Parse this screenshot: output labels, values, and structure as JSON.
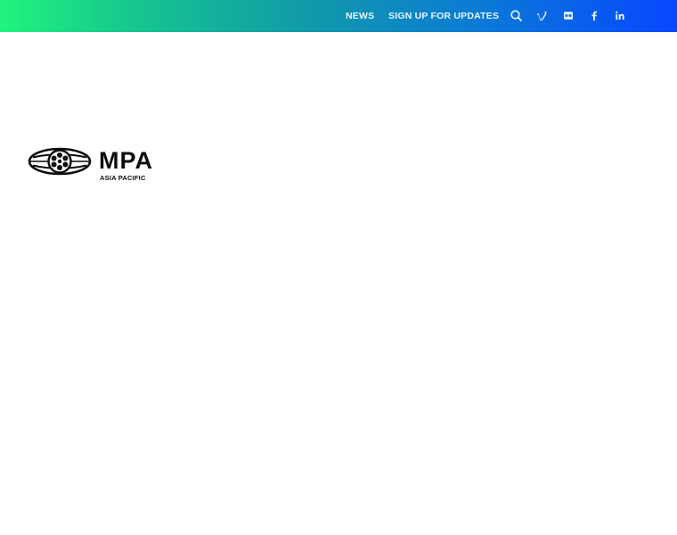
{
  "header": {
    "nav": [
      {
        "label": "NEWS"
      },
      {
        "label": "SIGN UP FOR UPDATES"
      }
    ],
    "icons": [
      "search-icon",
      "vimeo-icon",
      "flickr-icon",
      "facebook-icon",
      "linkedin-icon"
    ],
    "gradient_colors": [
      "#21f47d",
      "#119aa8",
      "#0747ff"
    ],
    "link_color": "#e8f6ff"
  },
  "brand": {
    "wordmark": "MPA",
    "subtitle": "ASIA PACIFIC",
    "color": "#0d0d0d"
  }
}
